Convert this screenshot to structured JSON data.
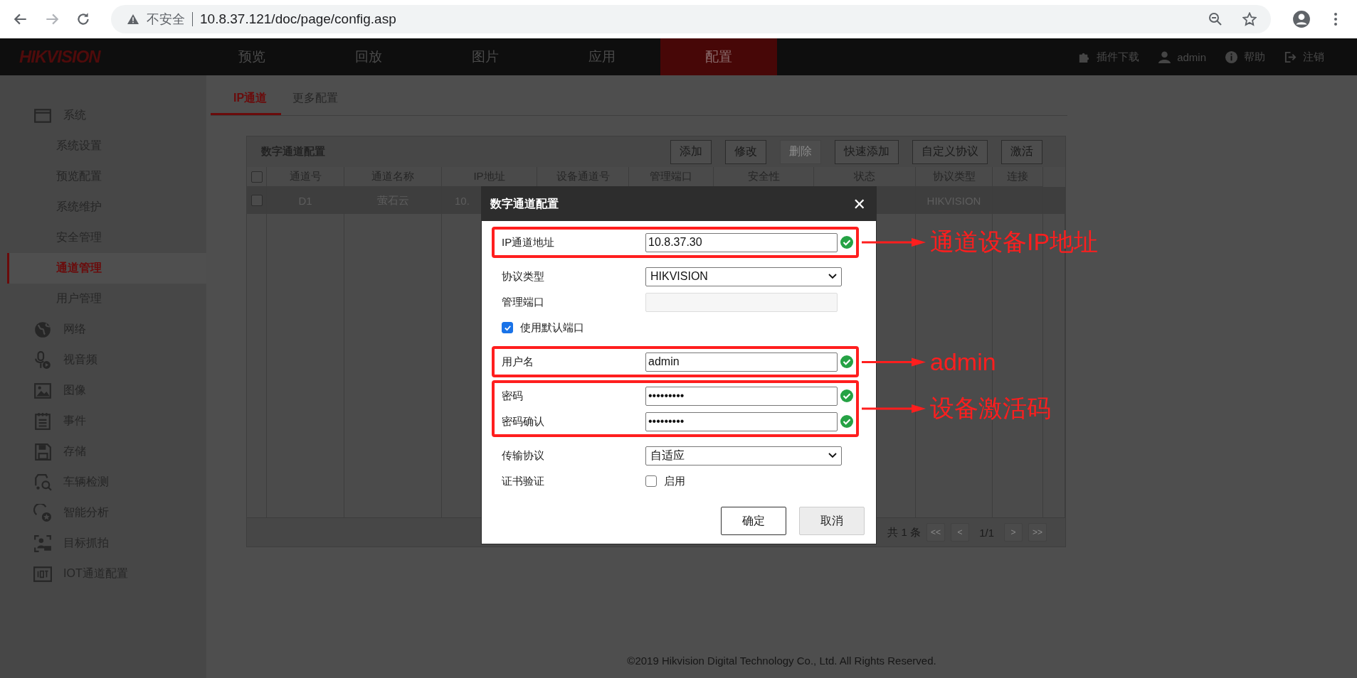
{
  "browser": {
    "security_label": "不安全",
    "url": "10.8.37.121/doc/page/config.asp"
  },
  "nav": {
    "logo": "HIKVISION",
    "items": [
      {
        "label": "预览",
        "selected": false
      },
      {
        "label": "回放",
        "selected": false
      },
      {
        "label": "图片",
        "selected": false
      },
      {
        "label": "应用",
        "selected": false
      },
      {
        "label": "配置",
        "selected": true
      }
    ],
    "links": [
      {
        "label": "插件下载"
      },
      {
        "label": "admin"
      },
      {
        "label": "帮助"
      },
      {
        "label": "注销"
      }
    ]
  },
  "sidebar": {
    "items": [
      {
        "label": "系统",
        "selected": false,
        "children": [
          {
            "label": "系统设置",
            "selected": false
          },
          {
            "label": "预览配置",
            "selected": false
          },
          {
            "label": "系统维护",
            "selected": false
          },
          {
            "label": "安全管理",
            "selected": false
          },
          {
            "label": "通道管理",
            "selected": true
          },
          {
            "label": "用户管理",
            "selected": false
          }
        ]
      },
      {
        "label": "网络",
        "selected": false
      },
      {
        "label": "视音频",
        "selected": false
      },
      {
        "label": "图像",
        "selected": false
      },
      {
        "label": "事件",
        "selected": false
      },
      {
        "label": "存储",
        "selected": false
      },
      {
        "label": "车辆检测",
        "selected": false
      },
      {
        "label": "智能分析",
        "selected": false
      },
      {
        "label": "目标抓拍",
        "selected": false
      },
      {
        "label": "IOT通道配置",
        "selected": false
      }
    ]
  },
  "tabs": [
    {
      "label": "IP通道",
      "selected": true
    },
    {
      "label": "更多配置",
      "selected": false
    }
  ],
  "panel": {
    "title": "数字通道配置",
    "buttons": [
      {
        "label": "添加",
        "disabled": false
      },
      {
        "label": "修改",
        "disabled": false
      },
      {
        "label": "删除",
        "disabled": true
      },
      {
        "label": "快速添加",
        "disabled": false
      },
      {
        "label": "自定义协议",
        "disabled": false
      },
      {
        "label": "激活",
        "disabled": false
      }
    ],
    "select_all_checked": false,
    "columns": [
      "通道号",
      "通道名称",
      "IP地址",
      "设备通道号",
      "管理端口",
      "安全性",
      "状态",
      "协议类型",
      "连接"
    ],
    "rows": [
      {
        "selected": true,
        "checked": false,
        "channel_no": "D1",
        "channel_name": "萤石云",
        "ip_address": "10.",
        "protocol_type": "HIKVISION"
      }
    ],
    "pagination": {
      "total": "共 1 条",
      "first": "<<",
      "prev": "<",
      "page": "1/1",
      "next": ">",
      "last": ">>"
    }
  },
  "dialog": {
    "title": "数字通道配置",
    "close": "✕",
    "groups": [
      {
        "highlighted": true,
        "note": "通道设备IP地址",
        "fields": [
          {
            "kind": "text",
            "label": "IP通道地址",
            "value": "10.8.37.30",
            "valid": true
          }
        ]
      },
      {
        "highlighted": false,
        "fields": [
          {
            "kind": "select",
            "label": "协议类型",
            "value": "HIKVISION"
          },
          {
            "kind": "text",
            "label": "管理端口",
            "disabled": true
          },
          {
            "kind": "checkbox",
            "label": "使用默认端口",
            "checked": true
          }
        ]
      },
      {
        "highlighted": true,
        "note": "admin",
        "fields": [
          {
            "kind": "text",
            "label": "用户名",
            "value": "admin",
            "valid": true
          }
        ]
      },
      {
        "highlighted": true,
        "note": "设备激活码",
        "fields": [
          {
            "kind": "text",
            "label": "密码",
            "value": "•••••••••",
            "valid": true
          },
          {
            "kind": "text",
            "label": "密码确认",
            "value": "•••••••••",
            "valid": true
          }
        ]
      },
      {
        "highlighted": false,
        "fields": [
          {
            "kind": "select",
            "label": "传输协议",
            "value": "自适应"
          },
          {
            "kind": "option",
            "label": "证书验证",
            "option": "启用",
            "checked": false
          }
        ]
      }
    ],
    "buttons": [
      {
        "label": "确定",
        "primary": true
      },
      {
        "label": "取消",
        "primary": false
      }
    ]
  },
  "footer": "©2019 Hikvision Digital Technology Co., Ltd. All Rights Reserved."
}
